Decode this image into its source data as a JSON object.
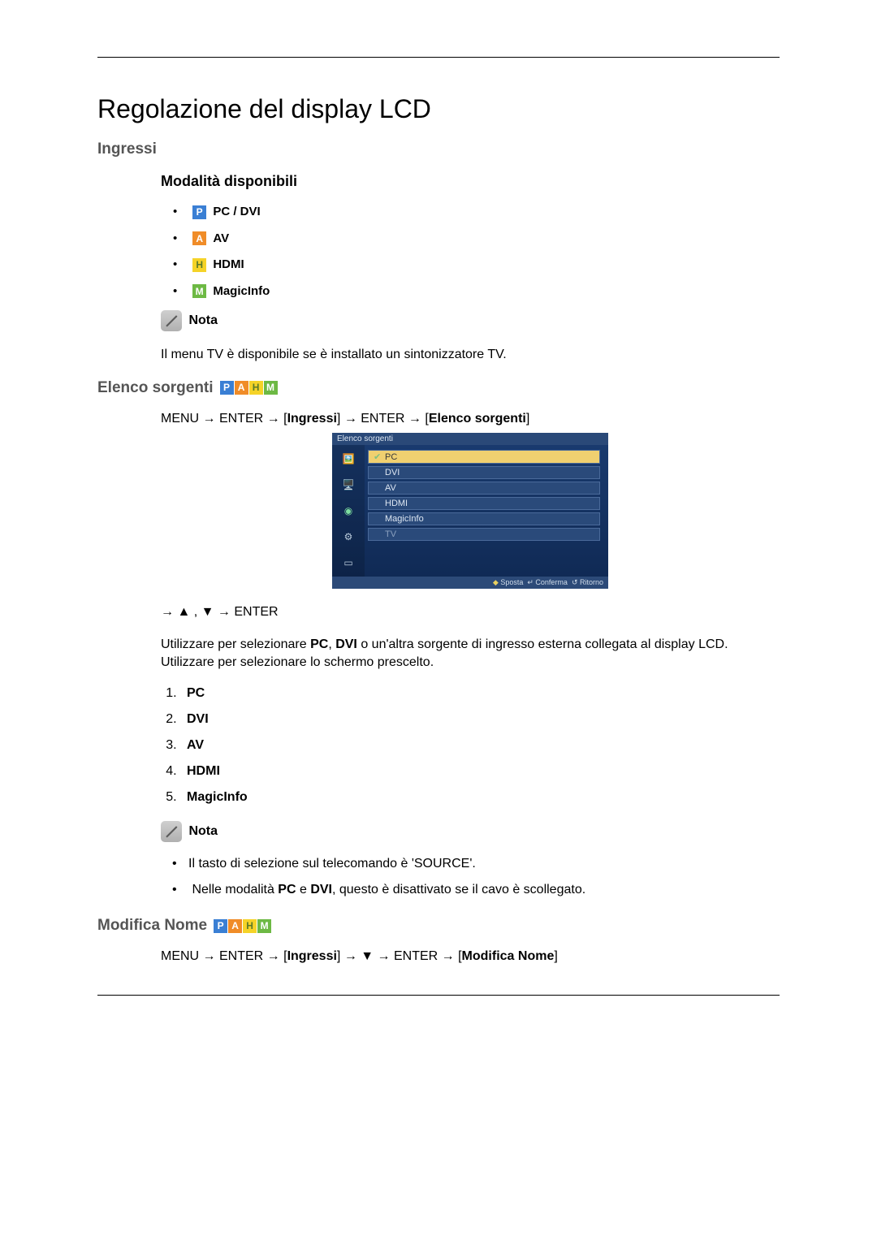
{
  "title": "Regolazione del display LCD",
  "ingressi": {
    "heading": "Ingressi",
    "modes_heading": "Modalità disponibili",
    "modes": [
      {
        "badge": "P",
        "cls": "badge-p",
        "label": "PC / DVI"
      },
      {
        "badge": "A",
        "cls": "badge-a",
        "label": "AV"
      },
      {
        "badge": "H",
        "cls": "badge-h",
        "label": "HDMI"
      },
      {
        "badge": "M",
        "cls": "badge-m",
        "label": "MagicInfo"
      }
    ],
    "note_label": "Nota",
    "note_text": "Il menu TV è disponibile se è installato un sintonizzatore TV."
  },
  "elenco": {
    "heading": "Elenco sorgenti",
    "nav_prefix": "MENU → ENTER → [",
    "nav_b1": "Ingressi",
    "nav_mid": "] → ENTER → [",
    "nav_b2": "Elenco sorgenti",
    "nav_suffix": "]",
    "osd": {
      "title": "Elenco sorgenti",
      "items": [
        "PC",
        "DVI",
        "AV",
        "HDMI",
        "MagicInfo",
        "TV"
      ],
      "footer_move": "Sposta",
      "footer_enter": "Conferma",
      "footer_return": "Ritorno"
    },
    "arrows_line": "→ ▲ , ▼ → ENTER",
    "desc_1": "Utilizzare per selezionare ",
    "desc_b1": "PC",
    "desc_2": ", ",
    "desc_b2": "DVI",
    "desc_3": " o un'altra sorgente di ingresso esterna collegata al display LCD. Utilizzare per selezionare lo schermo prescelto.",
    "sources": [
      "PC",
      "DVI",
      "AV",
      "HDMI",
      "MagicInfo"
    ],
    "note_label": "Nota",
    "note_bullets_1": "Il tasto di selezione sul telecomando è 'SOURCE'.",
    "note_bullets_2a": "Nelle modalità ",
    "note_bullets_2b1": "PC",
    "note_bullets_2mid": " e ",
    "note_bullets_2b2": "DVI",
    "note_bullets_2c": ", questo è disattivato se il cavo è scollegato."
  },
  "modifica": {
    "heading": "Modifica Nome",
    "nav_prefix": "MENU → ENTER → [",
    "nav_b1": "Ingressi",
    "nav_mid": "] → ▼ → ENTER → [",
    "nav_b2": "Modifica Nome",
    "nav_suffix": "]"
  }
}
